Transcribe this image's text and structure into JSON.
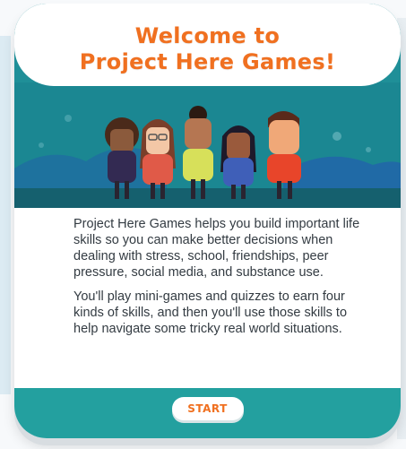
{
  "header": {
    "title_line1": "Welcome to",
    "title_line2": "Project Here Games!"
  },
  "body": {
    "paragraph1": "Project Here Games helps you build important life skills so you can make better decisions when dealing with stress, school, friendships, peer pressure, social media, and substance use.",
    "paragraph2": "You'll play mini-games and quizzes to earn four kinds of skills, and then you'll use those skills to help navigate some tricky real world situations."
  },
  "footer": {
    "start_label": "START"
  },
  "colors": {
    "title": "#f07020",
    "teal": "#23a09f",
    "scene_bg": "#1c8a94"
  },
  "illustration": {
    "characters": 5,
    "icon": "group-of-five-teens-illustration"
  }
}
